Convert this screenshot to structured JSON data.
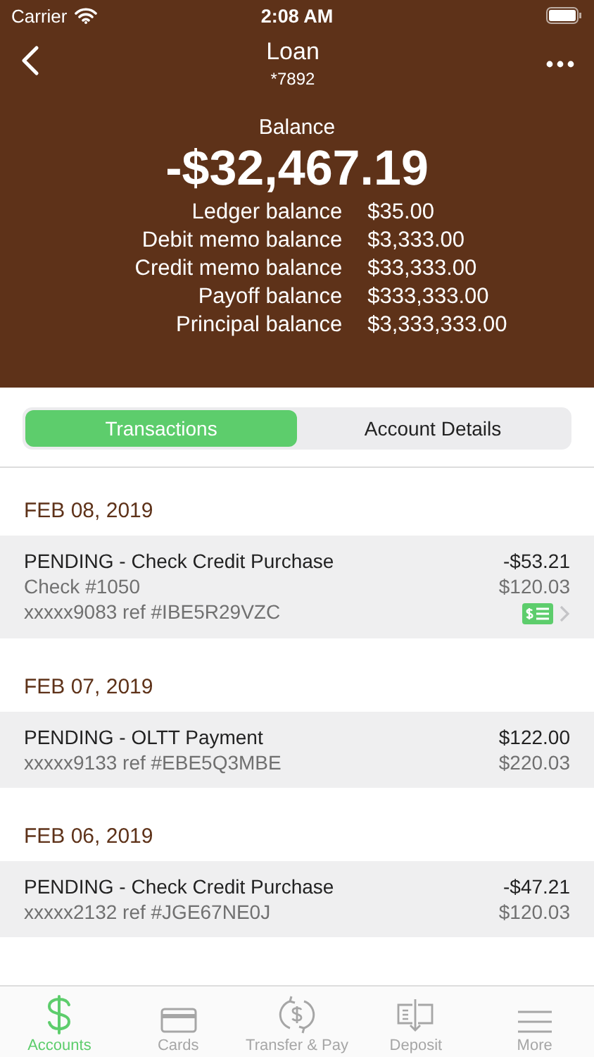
{
  "status_bar": {
    "carrier": "Carrier",
    "time": "2:08 AM"
  },
  "nav": {
    "title": "Loan",
    "subtitle": "*7892"
  },
  "balance": {
    "label": "Balance",
    "amount": "-$32,467.19",
    "details": [
      {
        "label": "Ledger balance",
        "value": "$35.00"
      },
      {
        "label": "Debit memo balance",
        "value": "$3,333.00"
      },
      {
        "label": "Credit memo balance",
        "value": "$33,333.00"
      },
      {
        "label": "Payoff balance",
        "value": "$333,333.00"
      },
      {
        "label": "Principal balance",
        "value": "$3,333,333.00"
      }
    ]
  },
  "segments": [
    {
      "label": "Transactions",
      "selected": true
    },
    {
      "label": "Account Details",
      "selected": false
    }
  ],
  "groups": [
    {
      "date": "FEB 08, 2019",
      "transactions": [
        {
          "title": "PENDING - Check Credit Purchase",
          "lines": [
            "Check #1050",
            "xxxxx9083 ref #IBE5R29VZC"
          ],
          "amount": "-$53.21",
          "balance": "$120.03",
          "check_image": true
        }
      ]
    },
    {
      "date": "FEB 07, 2019",
      "transactions": [
        {
          "title": "PENDING - OLTT Payment",
          "lines": [
            "xxxxx9133 ref #EBE5Q3MBE"
          ],
          "amount": "$122.00",
          "balance": "$220.03",
          "check_image": false
        }
      ]
    },
    {
      "date": "FEB 06, 2019",
      "transactions": [
        {
          "title": "PENDING - Check Credit Purchase",
          "lines": [
            "xxxxx2132 ref #JGE67NE0J"
          ],
          "amount": "-$47.21",
          "balance": "$120.03",
          "check_image": false
        }
      ]
    }
  ],
  "tab_bar": [
    {
      "kind": "dollar",
      "label": "Accounts",
      "selected": true
    },
    {
      "kind": "card",
      "label": "Cards",
      "selected": false
    },
    {
      "kind": "transfer",
      "label": "Transfer & Pay",
      "selected": false
    },
    {
      "kind": "deposit",
      "label": "Deposit",
      "selected": false
    },
    {
      "kind": "menu",
      "label": "More",
      "selected": false
    }
  ]
}
